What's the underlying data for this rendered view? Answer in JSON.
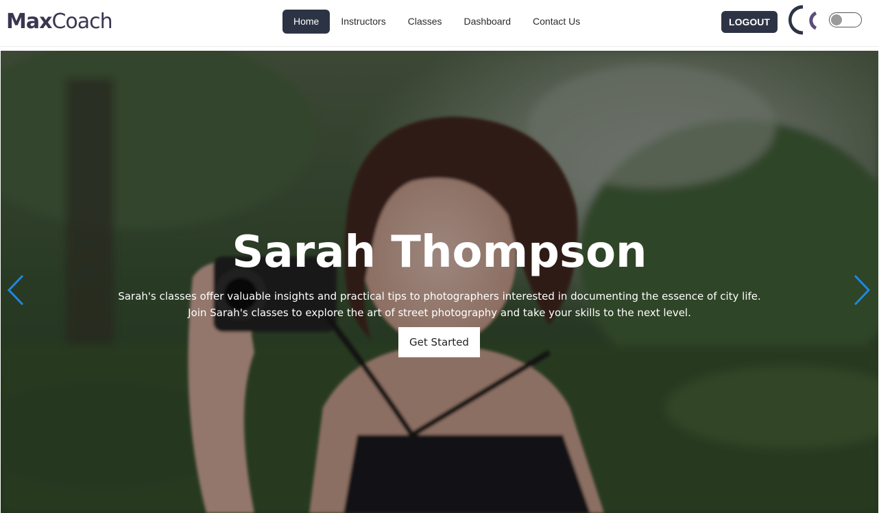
{
  "brand": {
    "part1": "Max",
    "part2": "Coach"
  },
  "nav": {
    "items": [
      {
        "label": "Home",
        "active": true
      },
      {
        "label": "Instructors",
        "active": false
      },
      {
        "label": "Classes",
        "active": false
      },
      {
        "label": "Dashboard",
        "active": false
      },
      {
        "label": "Contact Us",
        "active": false
      }
    ]
  },
  "header": {
    "logout_label": "LOGOUT",
    "theme_toggle_on": false
  },
  "hero": {
    "title": "Sarah Thompson",
    "description_line1": "Sarah's classes offer valuable insights and practical tips to photographers interested in documenting the essence of city life.",
    "description_line2": "Join Sarah's classes to explore the art of street photography and take your skills to the next level.",
    "cta_label": "Get Started"
  },
  "icons": {
    "prev": "chevron-left-icon",
    "next": "chevron-right-icon",
    "avatar": "user-avatar-icon"
  },
  "colors": {
    "dark_button": "#2c3344",
    "brand_text": "#3a3551",
    "arrow": "#1e88e5"
  }
}
